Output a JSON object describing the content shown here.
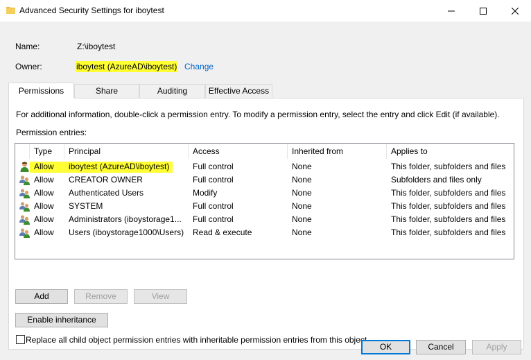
{
  "window": {
    "title": "Advanced Security Settings for iboytest",
    "minimize_glyph": "—",
    "maximize_glyph": "□",
    "close_glyph": "✕"
  },
  "header": {
    "name_label": "Name:",
    "name_value": "Z:\\iboytest",
    "owner_label": "Owner:",
    "owner_value": "iboytest (AzureAD\\iboytest)",
    "change_link": "Change",
    "highlight_color": "#ffff33",
    "link_color": "#0066cc"
  },
  "tabs": [
    {
      "label": "Permissions",
      "active": true
    },
    {
      "label": "Share",
      "active": false
    },
    {
      "label": "Auditing",
      "active": false
    },
    {
      "label": "Effective Access",
      "active": false
    }
  ],
  "permissions": {
    "info_text": "For additional information, double-click a permission entry. To modify a permission entry, select the entry and click Edit (if available).",
    "entries_label": "Permission entries:",
    "columns": [
      "Type",
      "Principal",
      "Access",
      "Inherited from",
      "Applies to"
    ],
    "rows": [
      {
        "icon": "user-icon",
        "type": "Allow",
        "principal": "iboytest (AzureAD\\iboytest)",
        "access": "Full control",
        "inherited": "None",
        "applies": "This folder, subfolders and files",
        "highlighted": true
      },
      {
        "icon": "group-icon",
        "type": "Allow",
        "principal": "CREATOR OWNER",
        "access": "Full control",
        "inherited": "None",
        "applies": "Subfolders and files only",
        "highlighted": false
      },
      {
        "icon": "group-icon",
        "type": "Allow",
        "principal": "Authenticated Users",
        "access": "Modify",
        "inherited": "None",
        "applies": "This folder, subfolders and files",
        "highlighted": false
      },
      {
        "icon": "group-icon",
        "type": "Allow",
        "principal": "SYSTEM",
        "access": "Full control",
        "inherited": "None",
        "applies": "This folder, subfolders and files",
        "highlighted": false
      },
      {
        "icon": "group-icon",
        "type": "Allow",
        "principal": "Administrators (iboystorage1...",
        "access": "Full control",
        "inherited": "None",
        "applies": "This folder, subfolders and files",
        "highlighted": false
      },
      {
        "icon": "group-icon",
        "type": "Allow",
        "principal": "Users (iboystorage1000\\Users)",
        "access": "Read & execute",
        "inherited": "None",
        "applies": "This folder, subfolders and files",
        "highlighted": false
      }
    ],
    "add_label": "Add",
    "remove_label": "Remove",
    "view_label": "View",
    "enable_inheritance_label": "Enable inheritance",
    "replace_label": "Replace all child object permission entries with inheritable permission entries from this object",
    "replace_checked": false
  },
  "footer": {
    "ok_label": "OK",
    "cancel_label": "Cancel",
    "apply_label": "Apply"
  }
}
